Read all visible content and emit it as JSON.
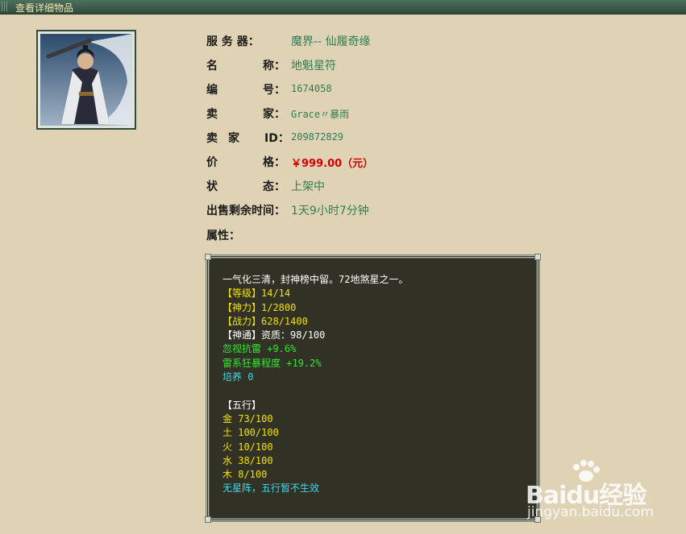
{
  "window": {
    "title": "查看详细物品"
  },
  "item": {
    "server_label": "服 务 器：",
    "server_value": "魔界-- 仙履奇缘",
    "name_label": "名 称：",
    "name_value": "地魁星符",
    "number_label": "编 号：",
    "number_value": "1674058",
    "seller_label": "卖 家：",
    "seller_value": "Grace〃暴雨",
    "seller_id_label": "卖 家 ID：",
    "seller_id_value": "209872829",
    "price_label": "价 格：",
    "price_value": "￥999.00（元）",
    "status_label": "状 态：",
    "status_value": "上架中",
    "time_label": "出售剩余时间：",
    "time_value": "1天9小时7分钟",
    "attr_label": "属性："
  },
  "description": {
    "intro": "一气化三清，封神榜中留。72地煞星之一。",
    "level": "【等级】14/14",
    "divine_power": "【神力】1/2800",
    "battle_power": "【战力】628/1400",
    "shentong_prefix": "【神通】",
    "aptitude": "资质：98/100",
    "ignore_thunder_resist": "忽视抗雷 +9.6%",
    "thunder_berserk": "雷系狂暴程度 +19.2%",
    "cultivate": "培养 0",
    "five_elements_title": "【五行】",
    "metal": "金 73/100",
    "earth": "土 100/100",
    "fire": "火 10/100",
    "water": "水 38/100",
    "wood": "木 8/100",
    "star_array": "无星阵，五行暂不生效"
  },
  "watermark": {
    "brand": "Baidu经验",
    "url": "jingyan.baidu.com"
  },
  "colors": {
    "background": "#e0d3b5",
    "value_green": "#2f7d52",
    "price_red": "#d40000",
    "desc_bg": "#323126"
  }
}
